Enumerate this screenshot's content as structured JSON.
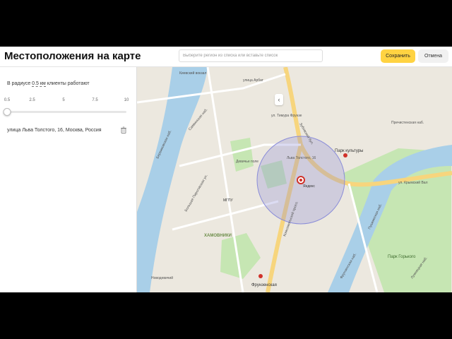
{
  "header": {
    "title": "Местоположения на карте",
    "search_placeholder": "Выберите регион из списка или вставьте список",
    "save_label": "Сохранить",
    "cancel_label": "Отмена"
  },
  "radius": {
    "prefix": "В радиусе",
    "value": "0.5 км",
    "suffix": "клиенты работают",
    "ticks": [
      "0.5",
      "2.5",
      "5",
      "7.5",
      "10"
    ],
    "slider_value_km": 0.5,
    "slider_min_km": 0.5,
    "slider_max_km": 10
  },
  "address": "улица Льва Толстого, 16, Москва, Россия",
  "map": {
    "zoom_in": "+",
    "zoom_out": "−",
    "collapse": "‹",
    "labels": {
      "park_kultury": "Парк культуры",
      "khamovniki": "ХАМОВНИКИ",
      "frunzenskaya": "Фрунзенская",
      "yandex": "Яндекс",
      "lva_tolstogo_16": "Льва Толстого, 16",
      "park_gorkogo": "Парк Горького",
      "mgpu": "МГПУ",
      "ulitsa_arbat": "улица Арбат",
      "krymsky_val": "ул. Крымский Вал",
      "prechistenskaya_nab": "Пречистенская наб.",
      "komsomolsky_prosp": "Комсомольский просп.",
      "zubovsky_bulvar": "Зубовский бул.",
      "frunzenskaya_nab": "Фрунзенская наб.",
      "berezhkovskaya_nab": "Бережковская наб.",
      "savvinskaya_nab": "Саввинская наб.",
      "kievsky_vokzal": "Киевский вокзал",
      "bolshaya_pirogovskaya": "Большая Пироговская ул.",
      "ulitsa_timura": "ул. Тимура Фрунзе",
      "devichye_pole": "Девичье поле",
      "novodevichy": "Новодевичий",
      "luzhnetskaya": "Лужнецкая наб.",
      "pushkinskaya_nab": "Пушкинская наб."
    },
    "circle_label": "Ореол 0.5 км",
    "colors": {
      "water": "#a9cfe8",
      "park": "#c6e6b3",
      "road": "#f7d57d",
      "circle": "#8a8cd8"
    }
  }
}
